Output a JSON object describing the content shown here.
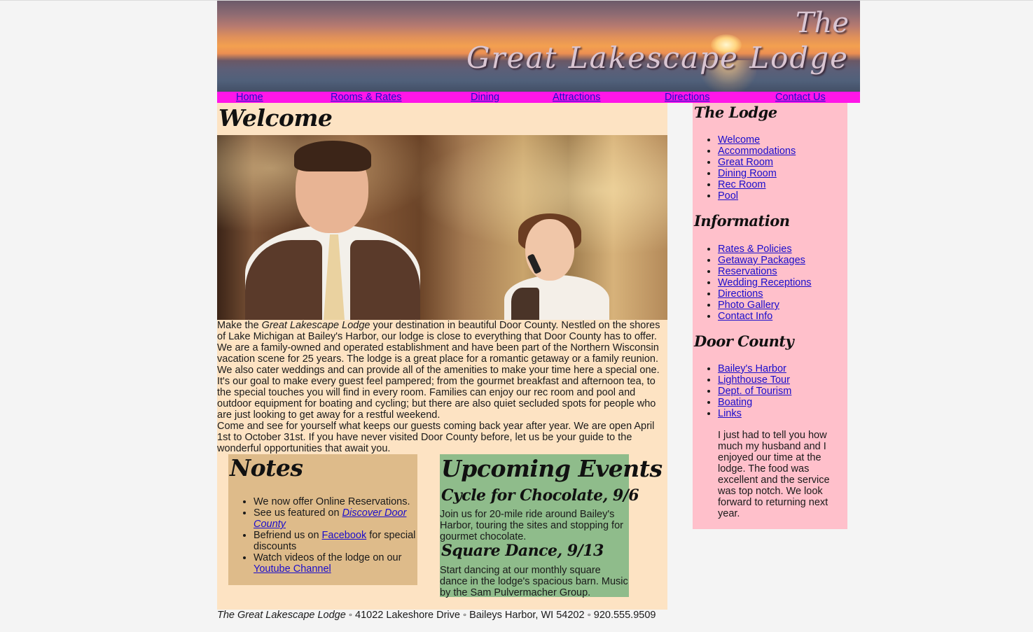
{
  "banner": {
    "title_line1": "The",
    "title_line2": "Great Lakescape Lodge"
  },
  "nav": [
    {
      "label": "Home"
    },
    {
      "label": "Rooms & Rates"
    },
    {
      "label": "Dining"
    },
    {
      "label": "Attractions"
    },
    {
      "label": "Directions"
    },
    {
      "label": "Contact Us"
    }
  ],
  "main": {
    "welcome_title": "Welcome",
    "intro_p1_start": "Make the ",
    "intro_p1_em": "Great Lakescape Lodge",
    "intro_p1_rest": " your destination in beautiful Door County. Nestled on the shores of Lake Michigan at Bailey's Harbor, our lodge is close to everything that Door County has to offer. We are a family-owned and operated establishment and have been part of the Northern Wisconsin vacation scene for 25 years. The lodge is a great place for a romantic getaway or a family reunion. We also cater weddings and can provide all of the amenities to make your time here a special one. It's our goal to make every guest feel pampered; from the gourmet breakfast and afternoon tea, to the special touches you will find in every room. Families can enjoy our rec room and pool and outdoor equipment for boating and cycling; but there are also quiet secluded spots for people who are just looking to get away for a restful weekend.",
    "intro_p2": "Come and see for yourself what keeps our guests coming back year after year. We are open April 1st to October 31st. If you have never visited Door County before, let us be your guide to the wonderful opportunities that await you."
  },
  "notes": {
    "title": "Notes",
    "item1": "We now offer Online Reservations.",
    "item2_pre": "See us featured on ",
    "item2_link": "Discover Door County",
    "item3_pre": "Befriend us on ",
    "item3_link": "Facebook",
    "item3_post": " for special discounts",
    "item4_pre": "Watch videos of the lodge on our ",
    "item4_link": "Youtube Channel"
  },
  "events": {
    "title": "Upcoming Events",
    "event1_title": "Cycle for Chocolate, 9/6",
    "event1_text": "Join us for 20-mile ride around Bailey's Harbor, touring the sites and stopping for gourmet chocolate.",
    "event2_title": "Square Dance, 9/13",
    "event2_text": "Start dancing at our monthly square dance in the lodge's spacious barn. Music by the Sam Pulvermacher Group."
  },
  "footer": {
    "name": "The Great Lakescape Lodge",
    "sep1": " ◦ ",
    "address": "41022 Lakeshore Drive",
    "sep2": " ◦ ",
    "city": "Baileys Harbor, WI 54202",
    "sep3": " ◦ ",
    "phone": "920.555.9509"
  },
  "sidebar": {
    "lodge_title": "The Lodge",
    "lodge_links": [
      "Welcome",
      "Accommodations",
      "Great Room",
      "Dining Room",
      "Rec Room",
      "Pool"
    ],
    "info_title": "Information",
    "info_links": [
      "Rates & Policies",
      "Getaway Packages",
      "Reservations",
      "Wedding Receptions",
      "Directions",
      "Photo Gallery",
      "Contact Info"
    ],
    "county_title": "Door County",
    "county_links": [
      "Bailey's Harbor",
      "Lighthouse Tour",
      "Dept. of Tourism",
      "Boating",
      "Links"
    ],
    "testimonial": "I just had to tell you how much my husband and I enjoyed our time at the lodge. The food was excellent and the service was top notch. We look forward to returning next year."
  },
  "colors": {
    "nav_bg": "#ff16e8",
    "main_bg": "#fde3c3",
    "notes_bg": "#debb8a",
    "events_bg": "#8fbc8b",
    "sidebar_bg": "#ffc0cb",
    "link": "#1a0dcc"
  }
}
